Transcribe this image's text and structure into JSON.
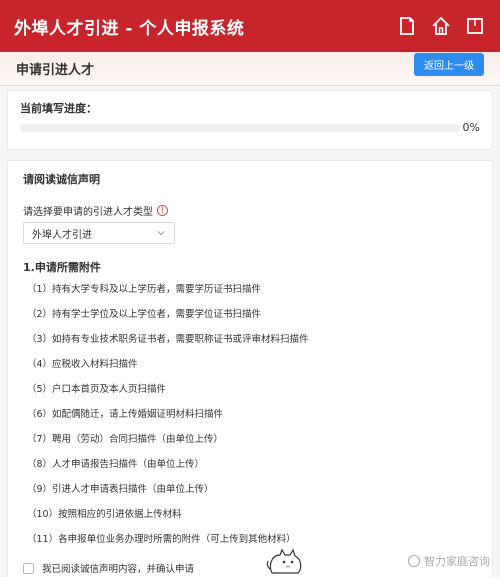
{
  "header": {
    "title": "外埠人才引进 - 个人申报系统",
    "icons": [
      "document-icon",
      "home-icon",
      "window-icon"
    ]
  },
  "page": {
    "title": "申请引进人才",
    "back_label": "返回上一级"
  },
  "progress": {
    "label": "当前填写进度：",
    "value": 0,
    "value_text": "0%"
  },
  "declaration": {
    "title": "请阅读诚信声明",
    "select_label": "请选择要申请的引进人才类型",
    "select_value": "外埠人才引进",
    "attachments_title": "1.申请所需附件",
    "attachments": [
      "（1）持有大学专科及以上学历者，需要学历证书扫描件",
      "（2）持有学士学位及以上学位者，需要学位证书扫描件",
      "（3）如持有专业技术职务证书者，需要职称证书或评审材料扫描件",
      "（4）应税收入材料扫描件",
      "（5）户口本首页及本人页扫描件",
      "（6）如配偶随迁，请上传婚姻证明材料扫描件",
      "（7）聘用（劳动）合同扫描件（由单位上传）",
      "（8）人才申请报告扫描件（由单位上传）",
      "（9）引进人才申请表扫描件（由单位上传）",
      "（10）按照相应的引进依据上传材料",
      "（11）各申报单位业务办理时所需的附件（可上传到其他材料）"
    ],
    "confirm_label": "我已阅读诚信声明内容，并确认申请"
  },
  "watermark": {
    "text": "智力家庭咨询"
  },
  "colors": {
    "brand": "#c8242c",
    "accent": "#2d8cf0"
  }
}
